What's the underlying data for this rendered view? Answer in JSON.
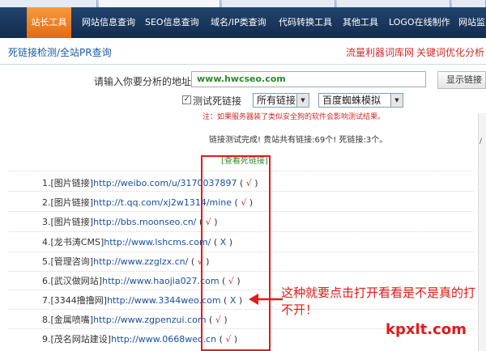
{
  "nav": {
    "items": [
      {
        "label": "站长工具",
        "active": true
      },
      {
        "label": "网站信息查询"
      },
      {
        "label": "SEO信息查询"
      },
      {
        "label": "域名/IP类查询"
      },
      {
        "label": "代码转换工具"
      },
      {
        "label": "其他工具"
      },
      {
        "label": "LOGO在线制作"
      },
      {
        "label": "网站监"
      }
    ]
  },
  "subbar": {
    "left": "死链接检测/全站PR查询",
    "right_1": "流量利器词库网",
    "right_2": "关键词优化分析"
  },
  "form": {
    "address_label": "请输入你要分析的地址:",
    "address_value": "www.hwcseo.com",
    "submit_label": "显示链接",
    "checkbox_label": "测试死链接",
    "select_links": "所有链接",
    "select_spider": "百度蜘蛛模拟",
    "notice": "注：如果服务器装了类似安全狗的软件会影响测试结果。"
  },
  "result": {
    "summary": "链接测试完成! 贵站共有链接:69个! 死链接:3个。",
    "view_dead": "[查看死链接]"
  },
  "links": [
    {
      "index": "1.",
      "tag": "[图片链接]",
      "url": "http://weibo.com/u/3170037897",
      "status": "√",
      "ok": true
    },
    {
      "index": "2.",
      "tag": "[图片链接]",
      "url": "http://t.qq.com/xj2w1314/mine",
      "status": "√",
      "ok": true
    },
    {
      "index": "3.",
      "tag": "[图片链接]",
      "url": "http://bbs.moonseo.cn/",
      "status": "√",
      "ok": true
    },
    {
      "index": "4.",
      "tag": "[龙书涛CMS]",
      "url": "http://www.lshcms.com/",
      "status": "X",
      "ok": false
    },
    {
      "index": "5.",
      "tag": "[管理咨询]",
      "url": "http://www.zzglzx.cn/",
      "status": "√",
      "ok": true
    },
    {
      "index": "6.",
      "tag": "[武汉做网站]",
      "url": "http://www.haojia027.com",
      "status": "√",
      "ok": true
    },
    {
      "index": "7.",
      "tag": "[3344撸撸网]",
      "url": "http://www.3344weo.com",
      "status": "X",
      "ok": false
    },
    {
      "index": "8.",
      "tag": "[金属喷嘴]",
      "url": "http://www.zgpenzui.com",
      "status": "√",
      "ok": true
    },
    {
      "index": "9.",
      "tag": "[茂名网站建设]",
      "url": "http://www.0668weo.cn",
      "status": "√",
      "ok": true
    }
  ],
  "annotation": "这种就要点击打开看看是不是真的打不开！",
  "watermark": "kpxlt.com",
  "colors": {
    "nav_bg": "#1a3a60",
    "nav_active": "#f08a2a",
    "accent_red": "#e11a1a",
    "link_blue": "#1a4fa0",
    "url_green": "#2c8a2c"
  }
}
